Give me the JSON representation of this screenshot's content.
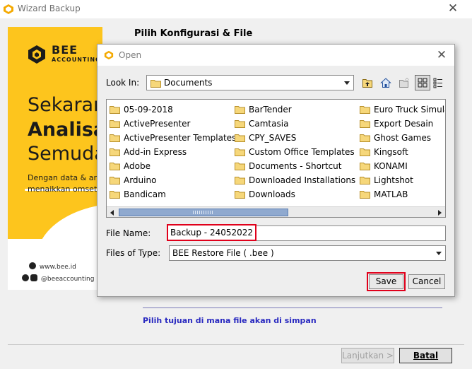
{
  "wizard": {
    "title": "Wizard Backup",
    "section_title": "Pilih Konfigurasi & File",
    "hint": "Pilih tujuan di mana file akan di simpan",
    "next_button": "Lanjutkan >",
    "cancel_button": "Batal"
  },
  "promo": {
    "brand": "BEE",
    "brand_sub": "ACCOUNTING",
    "headline_1": "Sekarang",
    "headline_2": "Analisa",
    "headline_3": "Semudah",
    "body_1": "Dengan data & angka",
    "body_2": "menaikkan omset",
    "website": "www.bee.id",
    "social": "@beeaccounting",
    "accent_color": "#fdc51d"
  },
  "dialog": {
    "title": "Open",
    "look_in_label": "Look In:",
    "look_in_value": "Documents",
    "columns": [
      [
        "05-09-2018",
        "ActivePresenter",
        "ActivePresenter Templates",
        "Add-in Express",
        "Adobe",
        "Arduino",
        "Bandicam"
      ],
      [
        "BarTender",
        "Camtasia",
        "CPY_SAVES",
        "Custom Office Templates",
        "Documents - Shortcut",
        "Downloaded Installations",
        "Downloads"
      ],
      [
        "Euro Truck Simulator",
        "Export Desain",
        "Ghost Games",
        "Kingsoft",
        "KONAMI",
        "Lightshot",
        "MATLAB"
      ]
    ],
    "file_name_label": "File Name:",
    "file_name_value": "Backup - 24052022",
    "file_type_label": "Files of Type:",
    "file_type_value": "BEE Restore File ( .bee )",
    "save_button": "Save",
    "cancel_button": "Cancel",
    "highlight_color": "#e0001b"
  }
}
